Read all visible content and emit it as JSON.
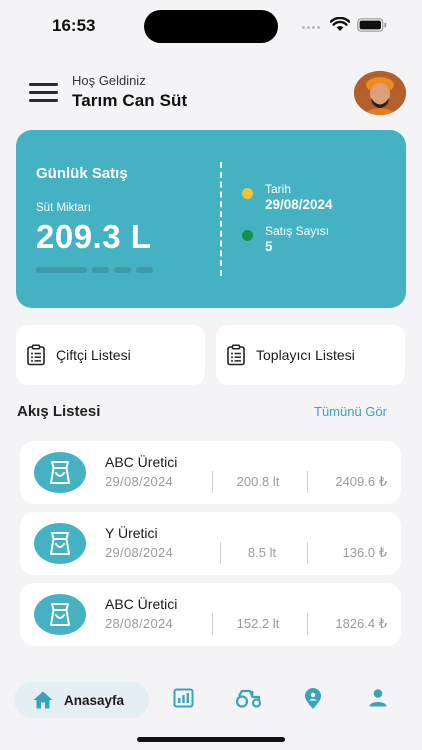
{
  "status_bar": {
    "time": "16:53"
  },
  "header": {
    "greeting": "Hoş Geldiniz",
    "company": "Tarım Can Süt"
  },
  "sales_card": {
    "title": "Günlük Satış",
    "metric_label": "Süt Miktarı",
    "metric_value": "209.3 L",
    "date_label": "Tarih",
    "date_value": "29/08/2024",
    "count_label": "Satış Sayısı",
    "count_value": "5",
    "date_dot_color": "#f4c430",
    "count_dot_color": "#13924f"
  },
  "quick_actions": {
    "farmers": {
      "label": "Çiftçi Listesi",
      "icon": "clipboard-list-icon"
    },
    "collectors": {
      "label": "Toplayıcı Listesi",
      "icon": "clipboard-list-icon"
    }
  },
  "flow_section": {
    "title": "Akış Listesi",
    "see_all": "Tümünü Gör"
  },
  "flow_items": [
    {
      "name": "ABC Üretici",
      "date": "29/08/2024",
      "amount": "200.8 lt",
      "total": "2409.6 ₺"
    },
    {
      "name": "Y Üretici",
      "date": "29/08/2024",
      "amount": "8.5 lt",
      "total": "136.0 ₺"
    },
    {
      "name": "ABC Üretici",
      "date": "28/08/2024",
      "amount": "152.2 lt",
      "total": "1826.4 ₺"
    }
  ],
  "bottom_nav": {
    "home": "Anasayfa",
    "items": [
      "home-icon",
      "report-icon",
      "tractor-icon",
      "location-pin-icon",
      "profile-icon"
    ]
  },
  "colors": {
    "accent": "#45b2c3",
    "link": "#3aa3b8",
    "background": "#f4f4f6"
  }
}
